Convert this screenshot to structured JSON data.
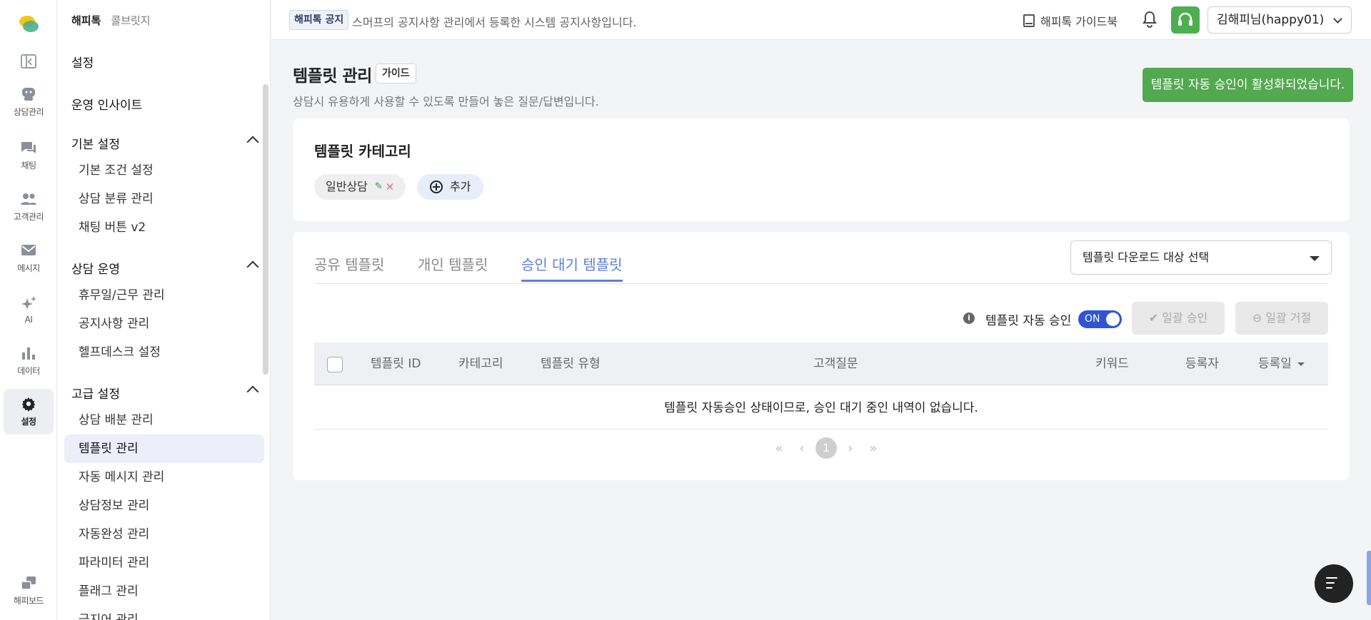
{
  "rail": {
    "items": [
      {
        "label": "상담관리",
        "icon": "chat-bubbles-icon"
      },
      {
        "label": "채팅",
        "icon": "chat-icon"
      },
      {
        "label": "고객관리",
        "icon": "users-icon"
      },
      {
        "label": "메시지",
        "icon": "mail-icon"
      },
      {
        "label": "AI",
        "icon": "sparkle-icon"
      },
      {
        "label": "데이터",
        "icon": "bar-chart-icon"
      },
      {
        "label": "설정",
        "icon": "gear-icon"
      },
      {
        "label": "해피보드",
        "icon": "board-icon"
      }
    ]
  },
  "sidebar": {
    "tabs": [
      "해피톡",
      "콜브릿지"
    ],
    "title": "설정",
    "insight": "운영 인사이트",
    "groups": [
      {
        "label": "기본 설정",
        "items": [
          "기본 조건 설정",
          "상담 분류 관리",
          "채팅 버튼 v2"
        ]
      },
      {
        "label": "상담 운영",
        "items": [
          "휴무일/근무 관리",
          "공지사항 관리",
          "헬프데스크 설정"
        ]
      },
      {
        "label": "고급 설정",
        "items": [
          "상담 배분 관리",
          "템플릿 관리",
          "자동 메시지 관리",
          "상담정보 관리",
          "자동완성 관리",
          "파라미터 관리",
          "플래그 관리",
          "금지어 관리"
        ]
      }
    ]
  },
  "topbar": {
    "notice_badge": "해피톡 공지",
    "notice_text": "스머프의 공지사항 관리에서 등록한 시스템 공지사항입니다.",
    "guidebook": "해피톡 가이드북",
    "user": "김해피님(happy01)"
  },
  "page": {
    "title": "템플릿 관리",
    "guide_button": "가이드",
    "description": "상담시 유용하게 사용할 수 있도록 만들어 놓은 질문/답변입니다.",
    "toast": "템플릿 자동 승인이 활성화되었습니다."
  },
  "category": {
    "heading": "템플릿 카테고리",
    "chip": "일반상담",
    "add_label": "추가"
  },
  "templates": {
    "tabs": [
      "공유 템플릿",
      "개인 템플릿",
      "승인 대기 템플릿"
    ],
    "active_tab": "승인 대기 템플릿",
    "download_select": "템플릿 다운로드 대상 선택",
    "auto_approve_label": "템플릿 자동 승인",
    "toggle_label": "ON",
    "bulk_approve": "일괄 승인",
    "bulk_reject": "일괄 거절",
    "columns": [
      "템플릿 ID",
      "카테고리",
      "템플릿 유형",
      "고객질문",
      "키워드",
      "등록자",
      "등록일"
    ],
    "empty_message": "템플릿 자동승인 상태이므로, 승인 대기 중인 내역이 없습니다.",
    "current_page": "1"
  },
  "colors": {
    "accent": "#5b7fd6",
    "success": "#52a94f",
    "toggle": "#2f54d6"
  }
}
